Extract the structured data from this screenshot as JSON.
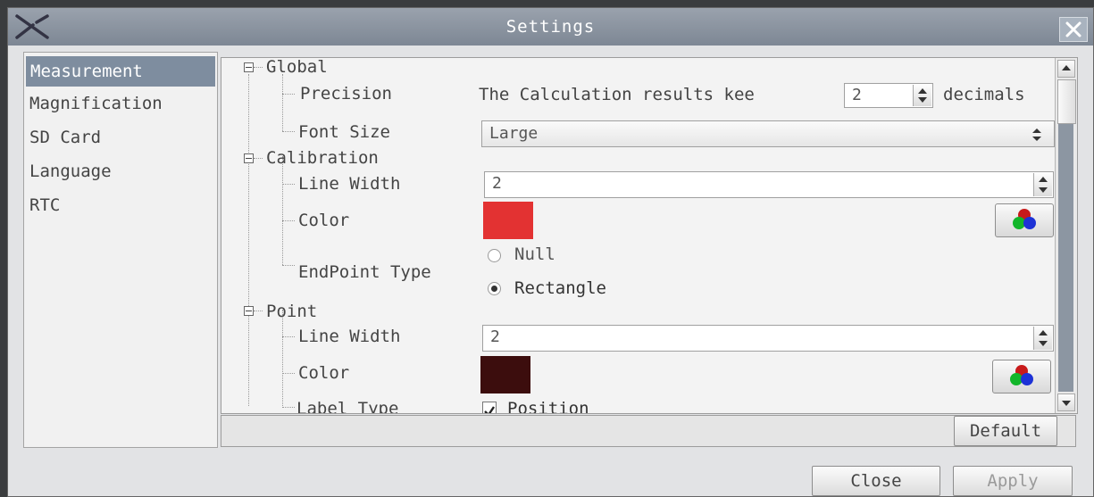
{
  "window": {
    "title": "Settings"
  },
  "sidebar": {
    "items": [
      {
        "label": "Measurement",
        "active": true
      },
      {
        "label": "Magnification"
      },
      {
        "label": "SD Card"
      },
      {
        "label": "Language"
      },
      {
        "label": "RTC"
      }
    ]
  },
  "global": {
    "label": "Global",
    "precision": {
      "label": "Precision",
      "description": "The Calculation results kee",
      "value": "2",
      "suffix": "decimals"
    },
    "font_size": {
      "label": "Font Size",
      "value": "Large"
    }
  },
  "calibration": {
    "label": "Calibration",
    "line_width": {
      "label": "Line Width",
      "value": "2"
    },
    "color": {
      "label": "Color",
      "swatch": "#e33232"
    },
    "endpoint_type": {
      "label": "EndPoint Type",
      "options": [
        {
          "label": "Null",
          "selected": false
        },
        {
          "label": "Rectangle",
          "selected": true
        }
      ]
    }
  },
  "point": {
    "label": "Point",
    "line_width": {
      "label": "Line Width",
      "value": "2"
    },
    "color": {
      "label": "Color",
      "swatch": "#3c0d0d"
    },
    "label_type": {
      "label": "Label Type",
      "option": "Position",
      "checked": true
    }
  },
  "buttons": {
    "default": "Default",
    "close": "Close",
    "apply": "Apply"
  },
  "icons": {
    "app": "x-tool-icon",
    "close": "close-icon",
    "color_picker": "rgb-circles-icon"
  }
}
